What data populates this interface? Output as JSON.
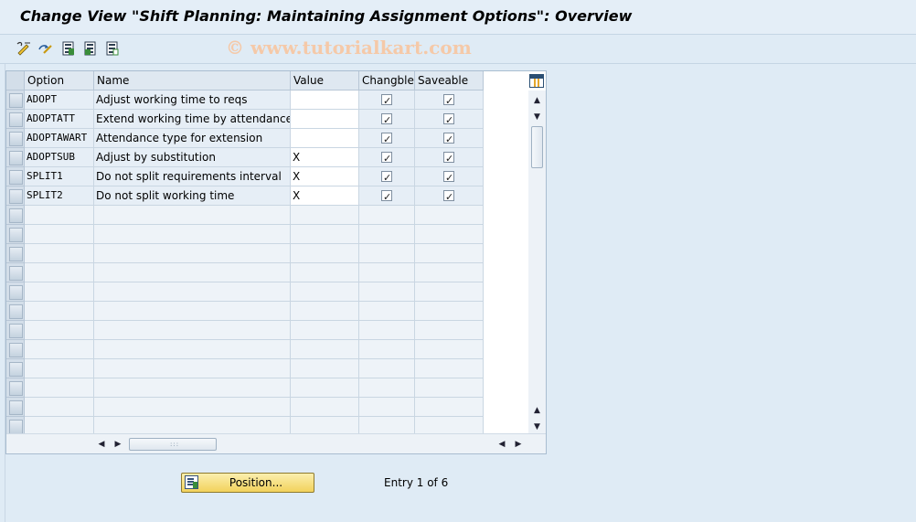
{
  "window": {
    "title": "Change View \"Shift Planning: Maintaining Assignment Options\": Overview"
  },
  "toolbar": {
    "buttons": [
      {
        "name": "display-change-icon"
      },
      {
        "name": "other-view-icon"
      },
      {
        "name": "select-all-icon"
      },
      {
        "name": "select-block-icon"
      },
      {
        "name": "deselect-all-icon"
      }
    ],
    "watermark": "© www.tutorialkart.com"
  },
  "table": {
    "columns": [
      "Option",
      "Name",
      "Value",
      "Changble",
      "Saveable"
    ],
    "rows": [
      {
        "option": "ADOPT",
        "name": "Adjust working time to reqs",
        "value": "",
        "changeable": true,
        "saveable": true
      },
      {
        "option": "ADOPTATT",
        "name": "Extend working time by attendance",
        "value": "",
        "changeable": true,
        "saveable": true
      },
      {
        "option": "ADOPTAWART",
        "name": "Attendance type for extension",
        "value": "",
        "changeable": true,
        "saveable": true
      },
      {
        "option": "ADOPTSUB",
        "name": "Adjust by substitution",
        "value": "X",
        "changeable": true,
        "saveable": true
      },
      {
        "option": "SPLIT1",
        "name": "Do not split requirements interval",
        "value": "X",
        "changeable": true,
        "saveable": true
      },
      {
        "option": "SPLIT2",
        "name": "Do not split working time",
        "value": "X",
        "changeable": true,
        "saveable": true
      }
    ],
    "empty_rows": 12
  },
  "footer": {
    "position_label": "Position...",
    "entry_text": "Entry 1 of 6"
  },
  "colors": {
    "background": "#dfebf5",
    "button_yellow": "#f2d25c",
    "header_cell": "#dfe8f1",
    "watermark": "#f5c9a8"
  }
}
